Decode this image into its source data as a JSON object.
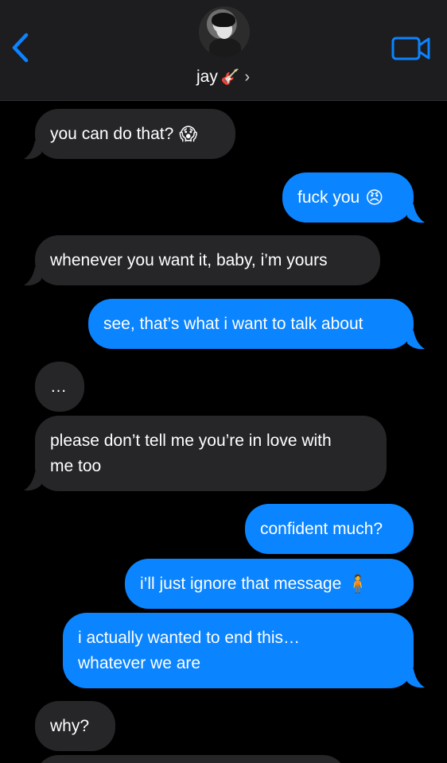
{
  "header": {
    "contact_name": "jay",
    "name_emoji": "🎸",
    "name_chevron": "›",
    "icons": {
      "back": "chevron-left-icon",
      "video": "video-camera-icon"
    },
    "colors": {
      "accent": "#0b84ff",
      "header_bg": "#1d1d1f",
      "incoming_bubble": "#262628",
      "outgoing_bubble": "#0b84ff"
    }
  },
  "messages": [
    {
      "direction": "in",
      "text": "you can do that?",
      "emoji": "😱"
    },
    {
      "direction": "out",
      "text": "fuck you",
      "emoji": "😠"
    },
    {
      "direction": "in",
      "text": "whenever you want it, baby, i’m yours"
    },
    {
      "direction": "out",
      "text": "see, that’s what i want to talk about"
    },
    {
      "direction": "in",
      "text": "…"
    },
    {
      "direction": "in",
      "text": "please don’t tell me you’re in love with me too"
    },
    {
      "direction": "out",
      "text": "confident much?"
    },
    {
      "direction": "out",
      "text": "i’ll just ignore that message",
      "emoji": "🧍"
    },
    {
      "direction": "out",
      "text": "i actually wanted to end this… whatever we are"
    },
    {
      "direction": "in",
      "text": "why?"
    }
  ]
}
